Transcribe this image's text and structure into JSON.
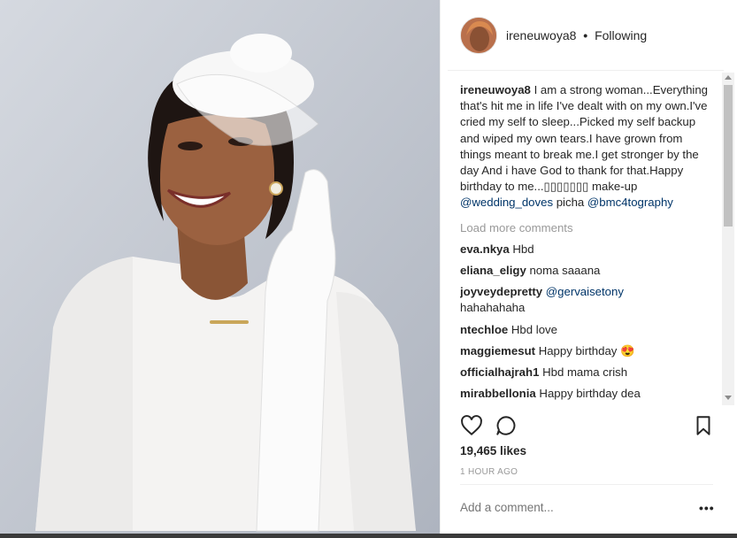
{
  "post": {
    "username": "ireneuwoya8",
    "separator": "•",
    "follow_status": "Following"
  },
  "caption": {
    "user": "ireneuwoya8",
    "text": "I am a strong woman...Everything that's hit me in life I've dealt with on my own.I've cried my self to sleep...Picked my self backup and wiped my own tears.I have grown from things meant to break me.I get stronger by the day And i have God to thank for that.Happy birthday to me...▯▯▯▯▯▯▯ make-up",
    "mention1": "@wedding_doves",
    "middle": "picha",
    "mention2": "@bmc4tography"
  },
  "load_more": "Load more comments",
  "comments": [
    {
      "user": "eva.nkya",
      "text": "Hbd"
    },
    {
      "user": "eliana_eligy",
      "text": "noma saaana"
    },
    {
      "user": "joyveydepretty",
      "mention": "@gervaisetony",
      "text": "hahahahaha"
    },
    {
      "user": "ntechloe",
      "text": "Hbd love"
    },
    {
      "user": "maggiemesut",
      "text": "Happy birthday 😍"
    },
    {
      "user": "officialhajrah1",
      "text": "Hbd mama crish"
    },
    {
      "user": "mirabbellonia",
      "text": "Happy birthday dea"
    }
  ],
  "stats": {
    "likes": "19,465 likes",
    "time": "1 HOUR AGO"
  },
  "comment_input": {
    "placeholder": "Add a comment...",
    "more": "•••"
  },
  "icons": {
    "like": "heart-icon",
    "comment": "comment-bubble-icon",
    "save": "bookmark-icon",
    "more": "more-options-icon"
  },
  "colors": {
    "mention": "#003569",
    "muted": "#999999",
    "text": "#262626"
  }
}
